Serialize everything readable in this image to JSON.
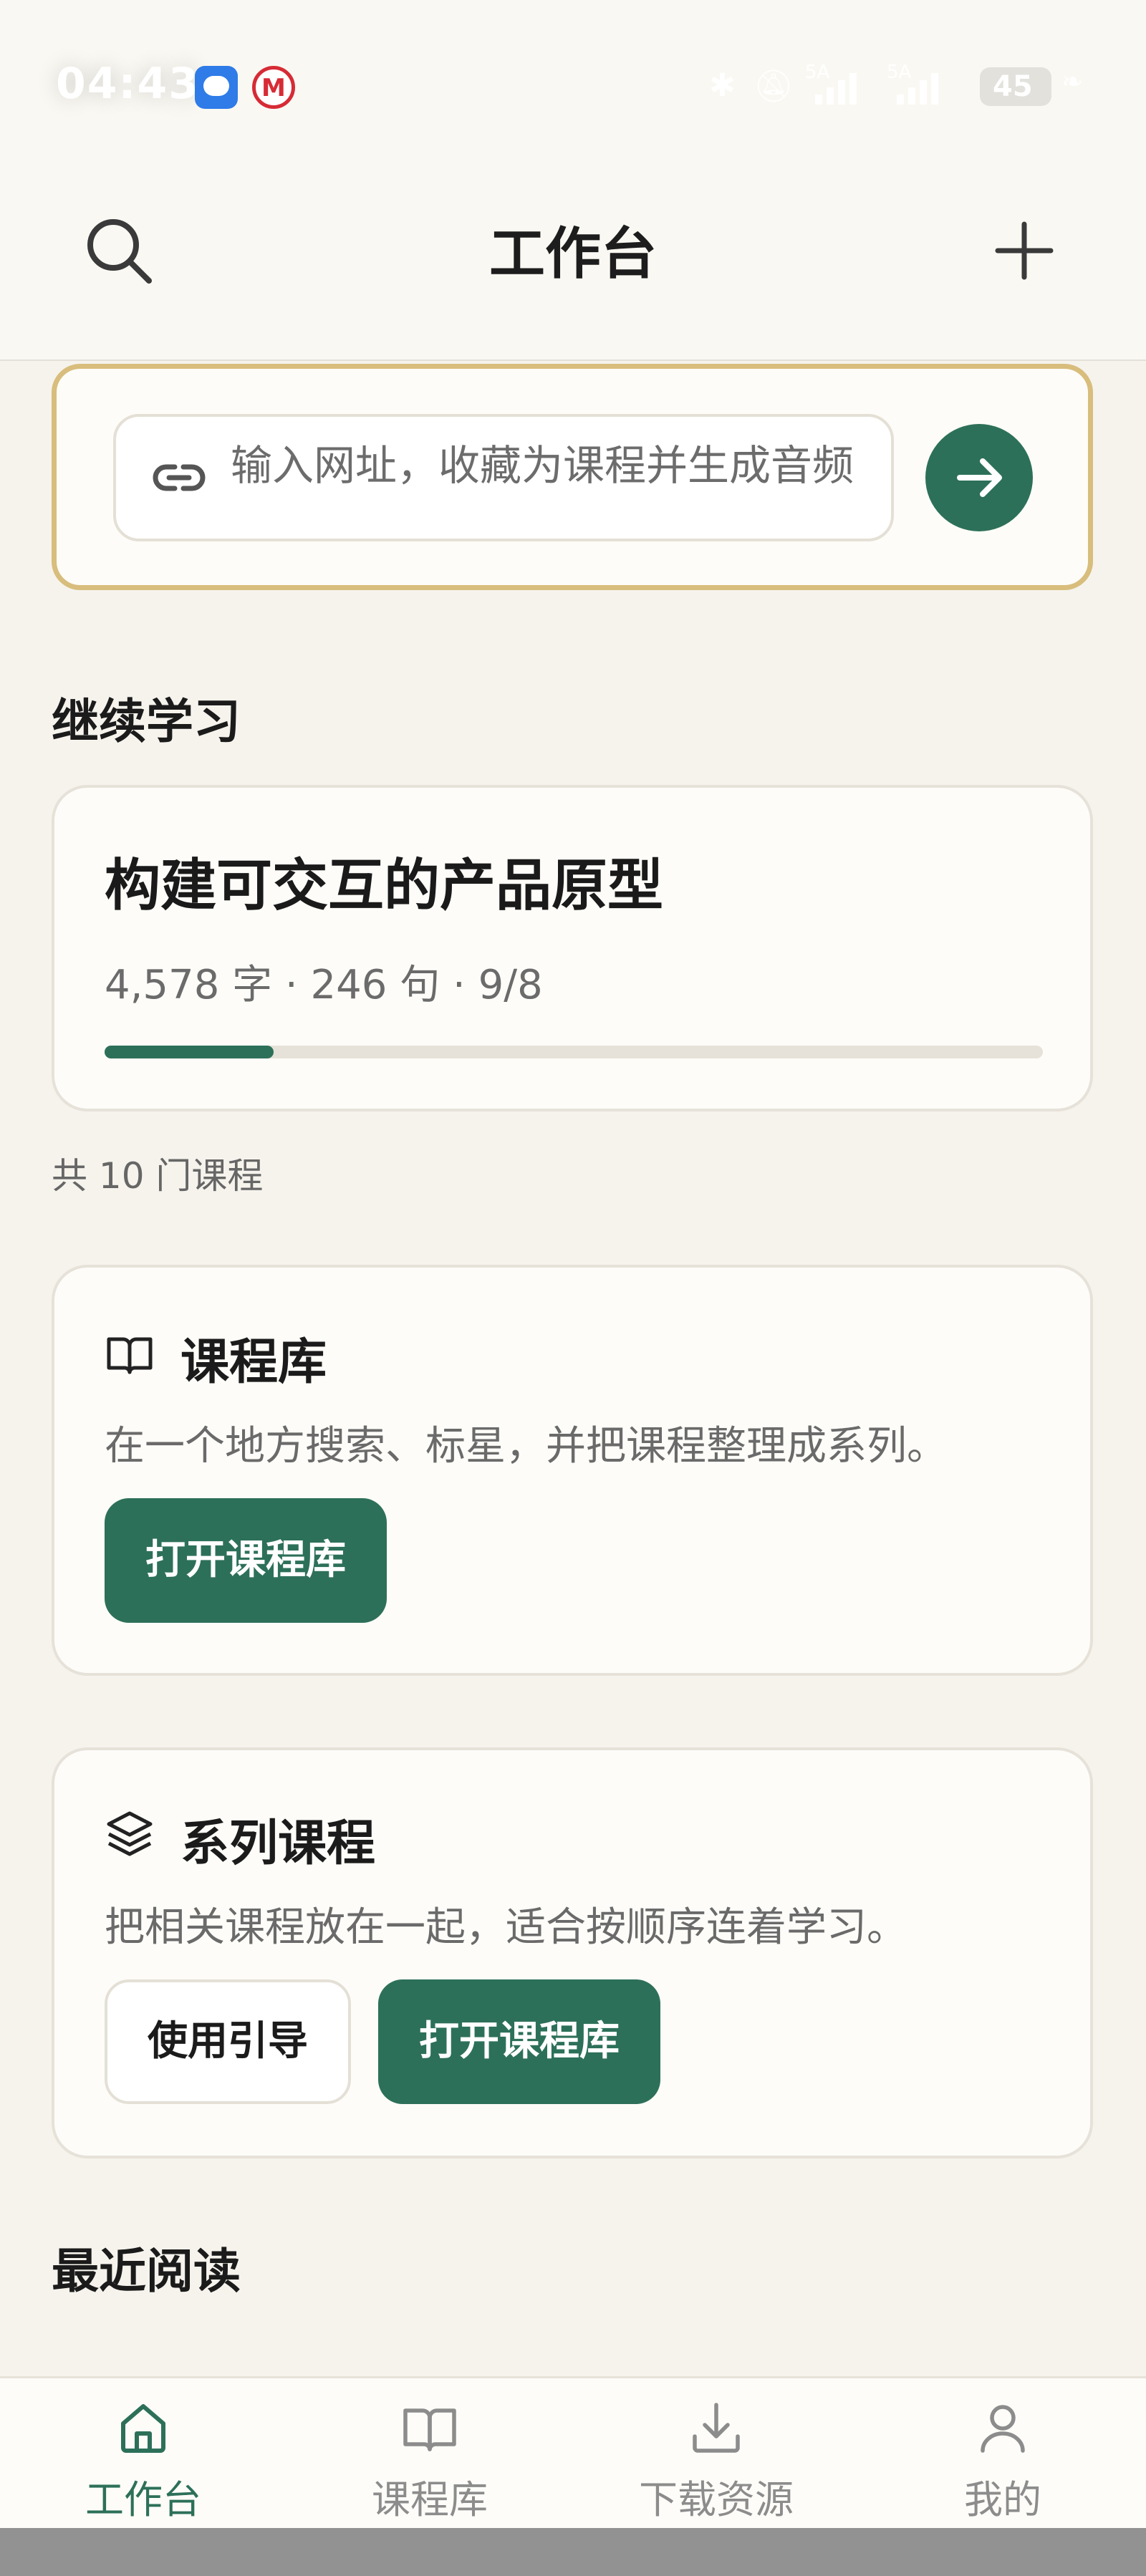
{
  "status_bar": {
    "time": "04:43",
    "network_1": "5A",
    "network_2": "5A",
    "battery": "45"
  },
  "header": {
    "title": "工作台"
  },
  "url_import": {
    "placeholder": "输入网址，收藏为课程并生成音频"
  },
  "continue_learning": {
    "section_title": "继续学习",
    "course": {
      "title": "构建可交互的产品原型",
      "meta": "4,578 字 · 246 句 · 9/8",
      "progress": 0.18
    },
    "course_count": "共 10 门课程"
  },
  "library_card": {
    "title": "课程库",
    "description": "在一个地方搜索、标星，并把课程整理成系列。",
    "open_button": "打开课程库"
  },
  "series_card": {
    "title": "系列课程",
    "description": "把相关课程放在一起，适合按顺序连着学习。",
    "guide_button": "使用引导",
    "open_button": "打开课程库"
  },
  "recent_reading": {
    "section_title": "最近阅读"
  },
  "bottom_nav": {
    "items": [
      {
        "label": "工作台",
        "icon": "home-icon",
        "active": true
      },
      {
        "label": "课程库",
        "icon": "book-icon",
        "active": false
      },
      {
        "label": "下载资源",
        "icon": "download-icon",
        "active": false
      },
      {
        "label": "我的",
        "icon": "user-icon",
        "active": false
      }
    ]
  },
  "colors": {
    "accent": "#2d7059",
    "highlight_border": "#d8bd7c",
    "background": "#f6f3ed"
  }
}
